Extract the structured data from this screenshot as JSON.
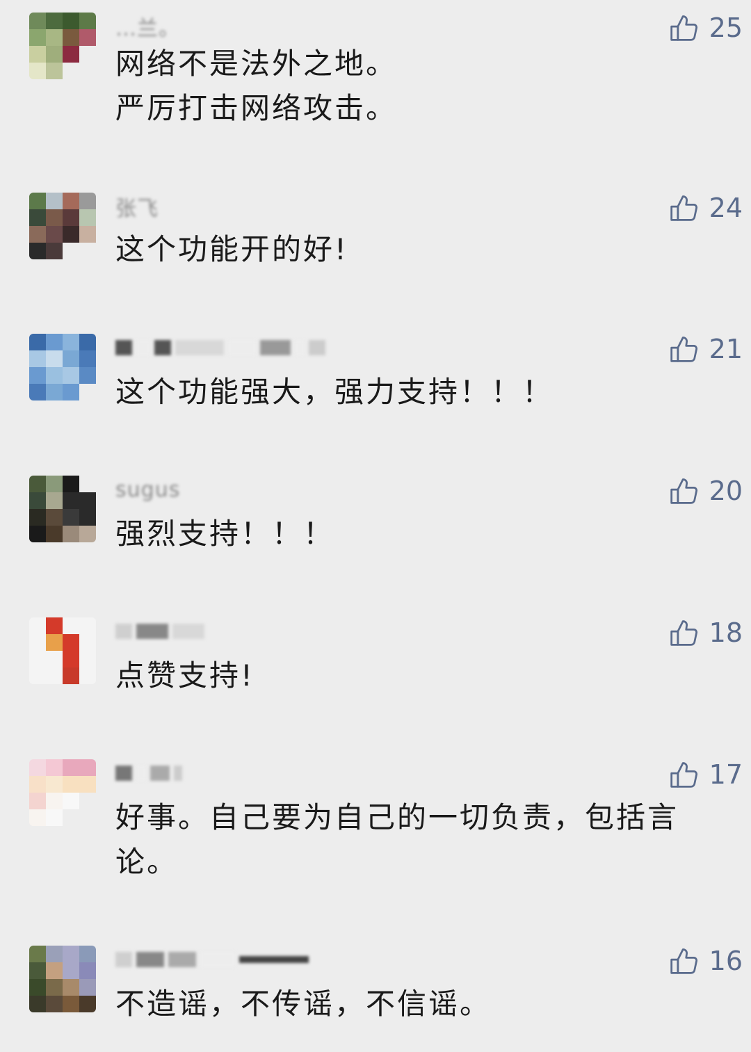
{
  "comments": [
    {
      "username": "…兰。",
      "text": "网络不是法外之地。\n严厉打击网络攻击。",
      "likes": "25"
    },
    {
      "username": "张飞",
      "text": "这个功能开的好!",
      "likes": "24"
    },
    {
      "username": "",
      "text": "这个功能强大，强力支持！！！",
      "likes": "21"
    },
    {
      "username": "sugus",
      "text": "强烈支持！！！",
      "likes": "20"
    },
    {
      "username": "",
      "text": "点赞支持!",
      "likes": "18"
    },
    {
      "username": "",
      "text": "好事。自己要为自己的一切负责，包括言\n论。",
      "likes": "17"
    },
    {
      "username": "",
      "text": "不造谣，不传谣，不信谣。",
      "likes": "16"
    }
  ],
  "icons": {
    "like": "thumbs-up-icon"
  },
  "colors": {
    "background": "#ededed",
    "like_accent": "#5a6b8c",
    "text": "#1a1a1a"
  }
}
